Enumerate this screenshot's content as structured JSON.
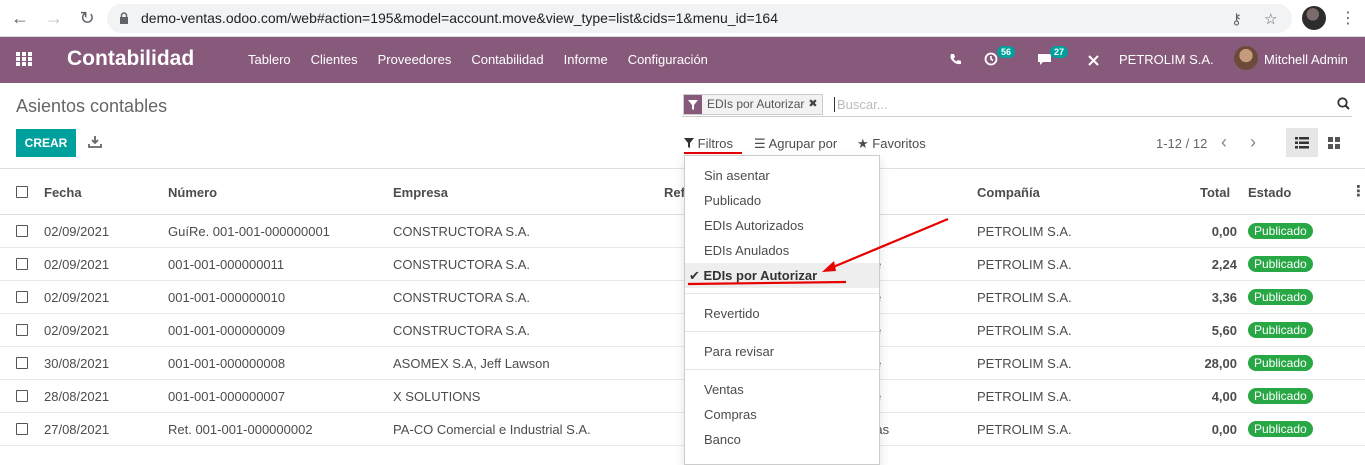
{
  "browser": {
    "url": "demo-ventas.odoo.com/web#action=195&model=account.move&view_type=list&cids=1&menu_id=164"
  },
  "navbar": {
    "brand": "Contabilidad",
    "menu": [
      "Tablero",
      "Clientes",
      "Proveedores",
      "Contabilidad",
      "Informe",
      "Configuración"
    ],
    "activity_count": "56",
    "message_count": "27",
    "company": "PETROLIM S.A.",
    "user": "Mitchell Admin"
  },
  "page": {
    "title": "Asientos contables",
    "create_label": "CREAR",
    "search_facet": "EDIs por Autorizar",
    "search_placeholder": "Buscar...",
    "filters_label": "Filtros",
    "group_by_label": "Agrupar por",
    "favorites_label": "Favoritos",
    "pager": "1-12 / 12"
  },
  "table": {
    "columns": [
      "Fecha",
      "Número",
      "Empresa",
      "Ref",
      "Compañía",
      "Total",
      "Estado"
    ],
    "rows": [
      {
        "fecha": "02/09/2021",
        "numero": "GuíRe. 001-001-000000001",
        "empresa": "CONSTRUCTORA S.A.",
        "partial": "",
        "compania": "PETROLIM S.A.",
        "total": "0,00",
        "estado": "Publicado"
      },
      {
        "fecha": "02/09/2021",
        "numero": "001-001-000000011",
        "empresa": "CONSTRUCTORA S.A.",
        "partial": "e",
        "compania": "PETROLIM S.A.",
        "total": "2,24",
        "estado": "Publicado"
      },
      {
        "fecha": "02/09/2021",
        "numero": "001-001-000000010",
        "empresa": "CONSTRUCTORA S.A.",
        "partial": "e",
        "compania": "PETROLIM S.A.",
        "total": "3,36",
        "estado": "Publicado"
      },
      {
        "fecha": "02/09/2021",
        "numero": "001-001-000000009",
        "empresa": "CONSTRUCTORA S.A.",
        "partial": "e",
        "compania": "PETROLIM S.A.",
        "total": "5,60",
        "estado": "Publicado"
      },
      {
        "fecha": "30/08/2021",
        "numero": "001-001-000000008",
        "empresa": "ASOMEX S.A, Jeff Lawson",
        "partial": "e",
        "compania": "PETROLIM S.A.",
        "total": "28,00",
        "estado": "Publicado"
      },
      {
        "fecha": "28/08/2021",
        "numero": "001-001-000000007",
        "empresa": "X SOLUTIONS",
        "partial": "e",
        "compania": "PETROLIM S.A.",
        "total": "4,00",
        "estado": "Publicado"
      },
      {
        "fecha": "27/08/2021",
        "numero": "Ret. 001-001-000000002",
        "empresa": "PA-CO Comercial e Industrial S.A.",
        "partial": "mpras",
        "compania": "PETROLIM S.A.",
        "total": "0,00",
        "estado": "Publicado"
      }
    ]
  },
  "filters_dropdown": {
    "items": [
      "Sin asentar",
      "Publicado",
      "EDIs Autorizados",
      "EDIs Anulados",
      "EDIs por Autorizar",
      "Revertido",
      "Para revisar",
      "Ventas",
      "Compras",
      "Banco"
    ]
  },
  "colors": {
    "navbar": "#875a7b",
    "primary_button": "#00a09d",
    "status_posted": "#28a745",
    "annotation_red": "#e60000"
  }
}
